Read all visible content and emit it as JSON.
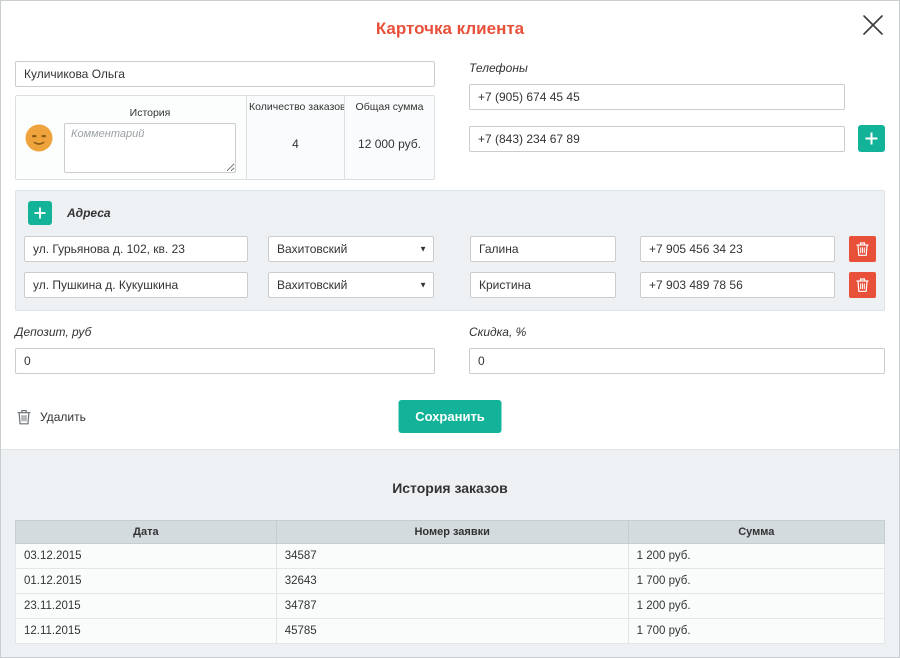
{
  "colors": {
    "accent_red": "#e8503a",
    "teal": "#12b398",
    "delete_red": "#e8503a",
    "section_bg": "#edf1f4",
    "table_header_bg": "#d4dbde"
  },
  "icons": {
    "chevron_down": "▼"
  },
  "modal": {
    "title": "Карточка клиента"
  },
  "client": {
    "name": "Куличикова Ольга",
    "phones_label": "Телефоны",
    "phones": [
      "+7 (905) 674 45 45",
      "+7 (843) 234 67 89"
    ],
    "summary": {
      "history_label": "История",
      "comment_placeholder": "Комментарий",
      "orders_count_label": "Количество заказов",
      "orders_count": "4",
      "total_sum_label": "Общая сумма",
      "total_sum": "12 000 руб."
    }
  },
  "addresses": {
    "label": "Адреса",
    "rows": [
      {
        "address": "ул. Гурьянова д. 102, кв. 23",
        "district": "Вахитовский",
        "contact_name": "Галина",
        "phone": "+7 905 456 34 23"
      },
      {
        "address": "ул. Пушкина д. Кукушкина",
        "district": "Вахитовский",
        "contact_name": "Кристина",
        "phone": "+7 903 489 78 56"
      }
    ]
  },
  "finance": {
    "deposit_label": "Депозит, руб",
    "deposit_value": "0",
    "discount_label": "Скидка, %",
    "discount_value": "0"
  },
  "actions": {
    "delete_label": "Удалить",
    "save_label": "Сохранить"
  },
  "order_history": {
    "title": "История заказов",
    "columns": [
      "Дата",
      "Номер заявки",
      "Сумма"
    ],
    "rows": [
      [
        "03.12.2015",
        "34587",
        "1 200 руб."
      ],
      [
        "01.12.2015",
        "32643",
        "1 700 руб."
      ],
      [
        "23.11.2015",
        "34787",
        "1 200 руб."
      ],
      [
        "12.11.2015",
        "45785",
        "1 700 руб."
      ]
    ]
  }
}
